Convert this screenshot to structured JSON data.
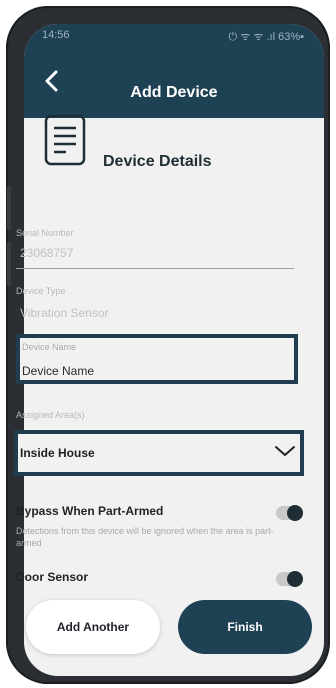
{
  "status_bar": {
    "time": "14:56",
    "indicators": "⏻ ᯤ ᯤ .ıl 63%▪"
  },
  "header": {
    "title": "Add Device",
    "back_icon": "chevron-left-icon"
  },
  "section": {
    "title": "Device Details",
    "icon": "document-icon"
  },
  "fields": {
    "serial": {
      "label": "Serial Number",
      "value": "23068757"
    },
    "type": {
      "label": "Device Type",
      "value": "Vibration Sensor"
    },
    "name": {
      "label": "Device Name",
      "value": "Device Name"
    },
    "area": {
      "label": "Assigned Area(s)",
      "value": "Inside House",
      "icon": "chevron-down-icon"
    }
  },
  "toggles": {
    "bypass": {
      "title": "Bypass When Part-Armed",
      "description": "Detections from this device will be ignored when the area is part-armed"
    },
    "door": {
      "title": "Door Sensor"
    }
  },
  "buttons": {
    "add_another": "Add Another",
    "finish": "Finish"
  },
  "colors": {
    "primary": "#1f4154",
    "highlight_border": "#1f3d4f",
    "background": "#f1f1f1"
  }
}
